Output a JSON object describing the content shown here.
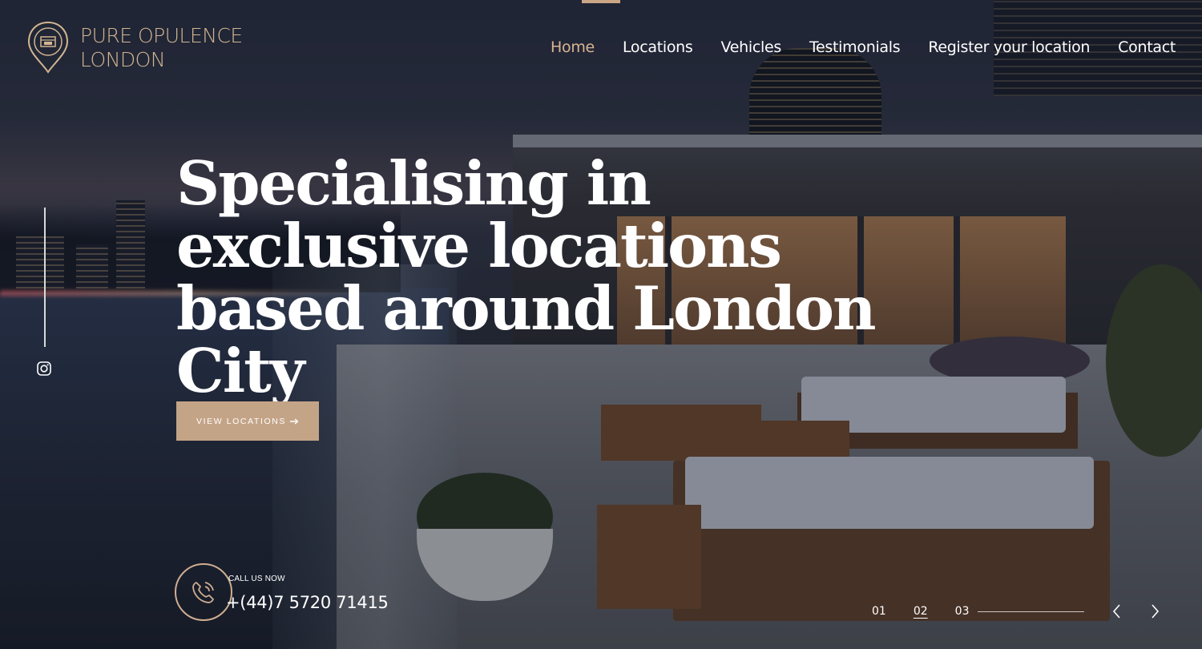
{
  "brand": {
    "line1": "PURE OPULENCE",
    "line2": "LONDON",
    "accent_color": "#d2b691"
  },
  "nav": {
    "items": [
      {
        "label": "Home",
        "active": true
      },
      {
        "label": "Locations"
      },
      {
        "label": "Vehicles"
      },
      {
        "label": "Testimonials"
      },
      {
        "label": "Register your location"
      },
      {
        "label": "Contact"
      }
    ],
    "active_color": "#d8b594"
  },
  "social": {
    "icon": "instagram-icon"
  },
  "hero": {
    "headline": "Specialising in exclusive locations based around London City",
    "cta_label": "VIEW LOCATIONS",
    "cta_icon": "arrow-right-icon",
    "cta_color": "#c4a487"
  },
  "call": {
    "label": "CALL US NOW",
    "number": "+(44)7 5720 71415",
    "icon": "phone-icon"
  },
  "slider": {
    "slides": [
      "01",
      "02",
      "03"
    ],
    "active_index": 1,
    "prev_icon": "chevron-left-icon",
    "next_icon": "chevron-right-icon"
  }
}
